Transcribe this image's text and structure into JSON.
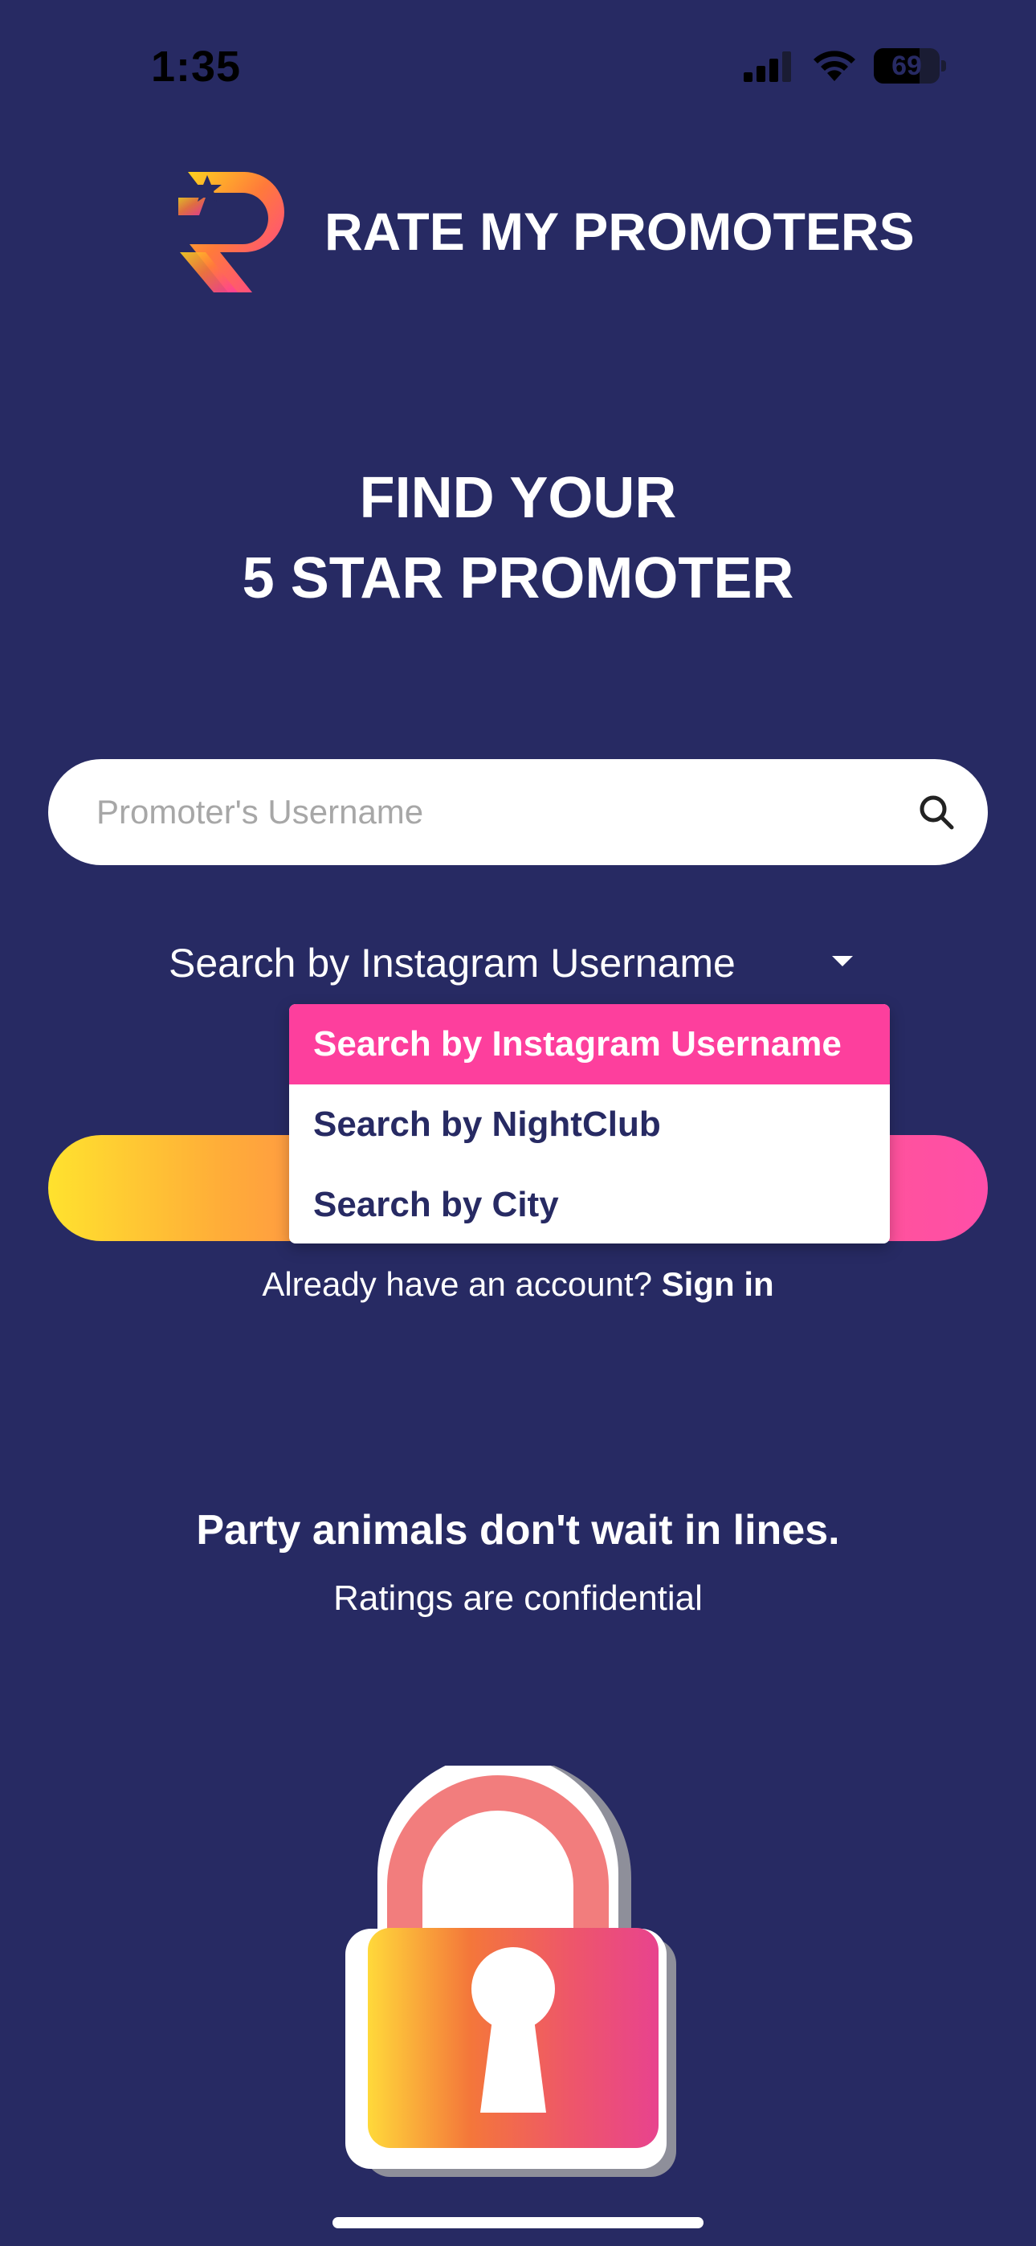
{
  "status_bar": {
    "time": "1:35",
    "battery": "69",
    "battery_level": 0.69,
    "icons": [
      "signal-icon",
      "wifi-icon",
      "battery-icon"
    ]
  },
  "brand": {
    "name": "RATE MY PROMOTERS",
    "logo": "rmp-logo"
  },
  "hero": {
    "line1": "FIND YOUR",
    "line2": "5 STAR PROMOTER"
  },
  "search": {
    "placeholder": "Promoter's Username",
    "value": "",
    "icon": "search-icon"
  },
  "search_type": {
    "selected": "Search by Instagram Username",
    "options": [
      "Search by Instagram Username",
      "Search by NightClub",
      "Search by City"
    ]
  },
  "account": {
    "prompt": "Already have an account?",
    "signin_label": "Sign in"
  },
  "tagline": {
    "title": "Party animals don't wait in lines.",
    "subtitle": "Ratings are confidential"
  },
  "illustration": {
    "icon": "lock-icon"
  },
  "colors": {
    "background": "#272a63",
    "accent_pink": "#fd3f9d",
    "gradient_start": "#ffe22e",
    "gradient_end": "#ff4ea8",
    "text": "#ffffff"
  }
}
